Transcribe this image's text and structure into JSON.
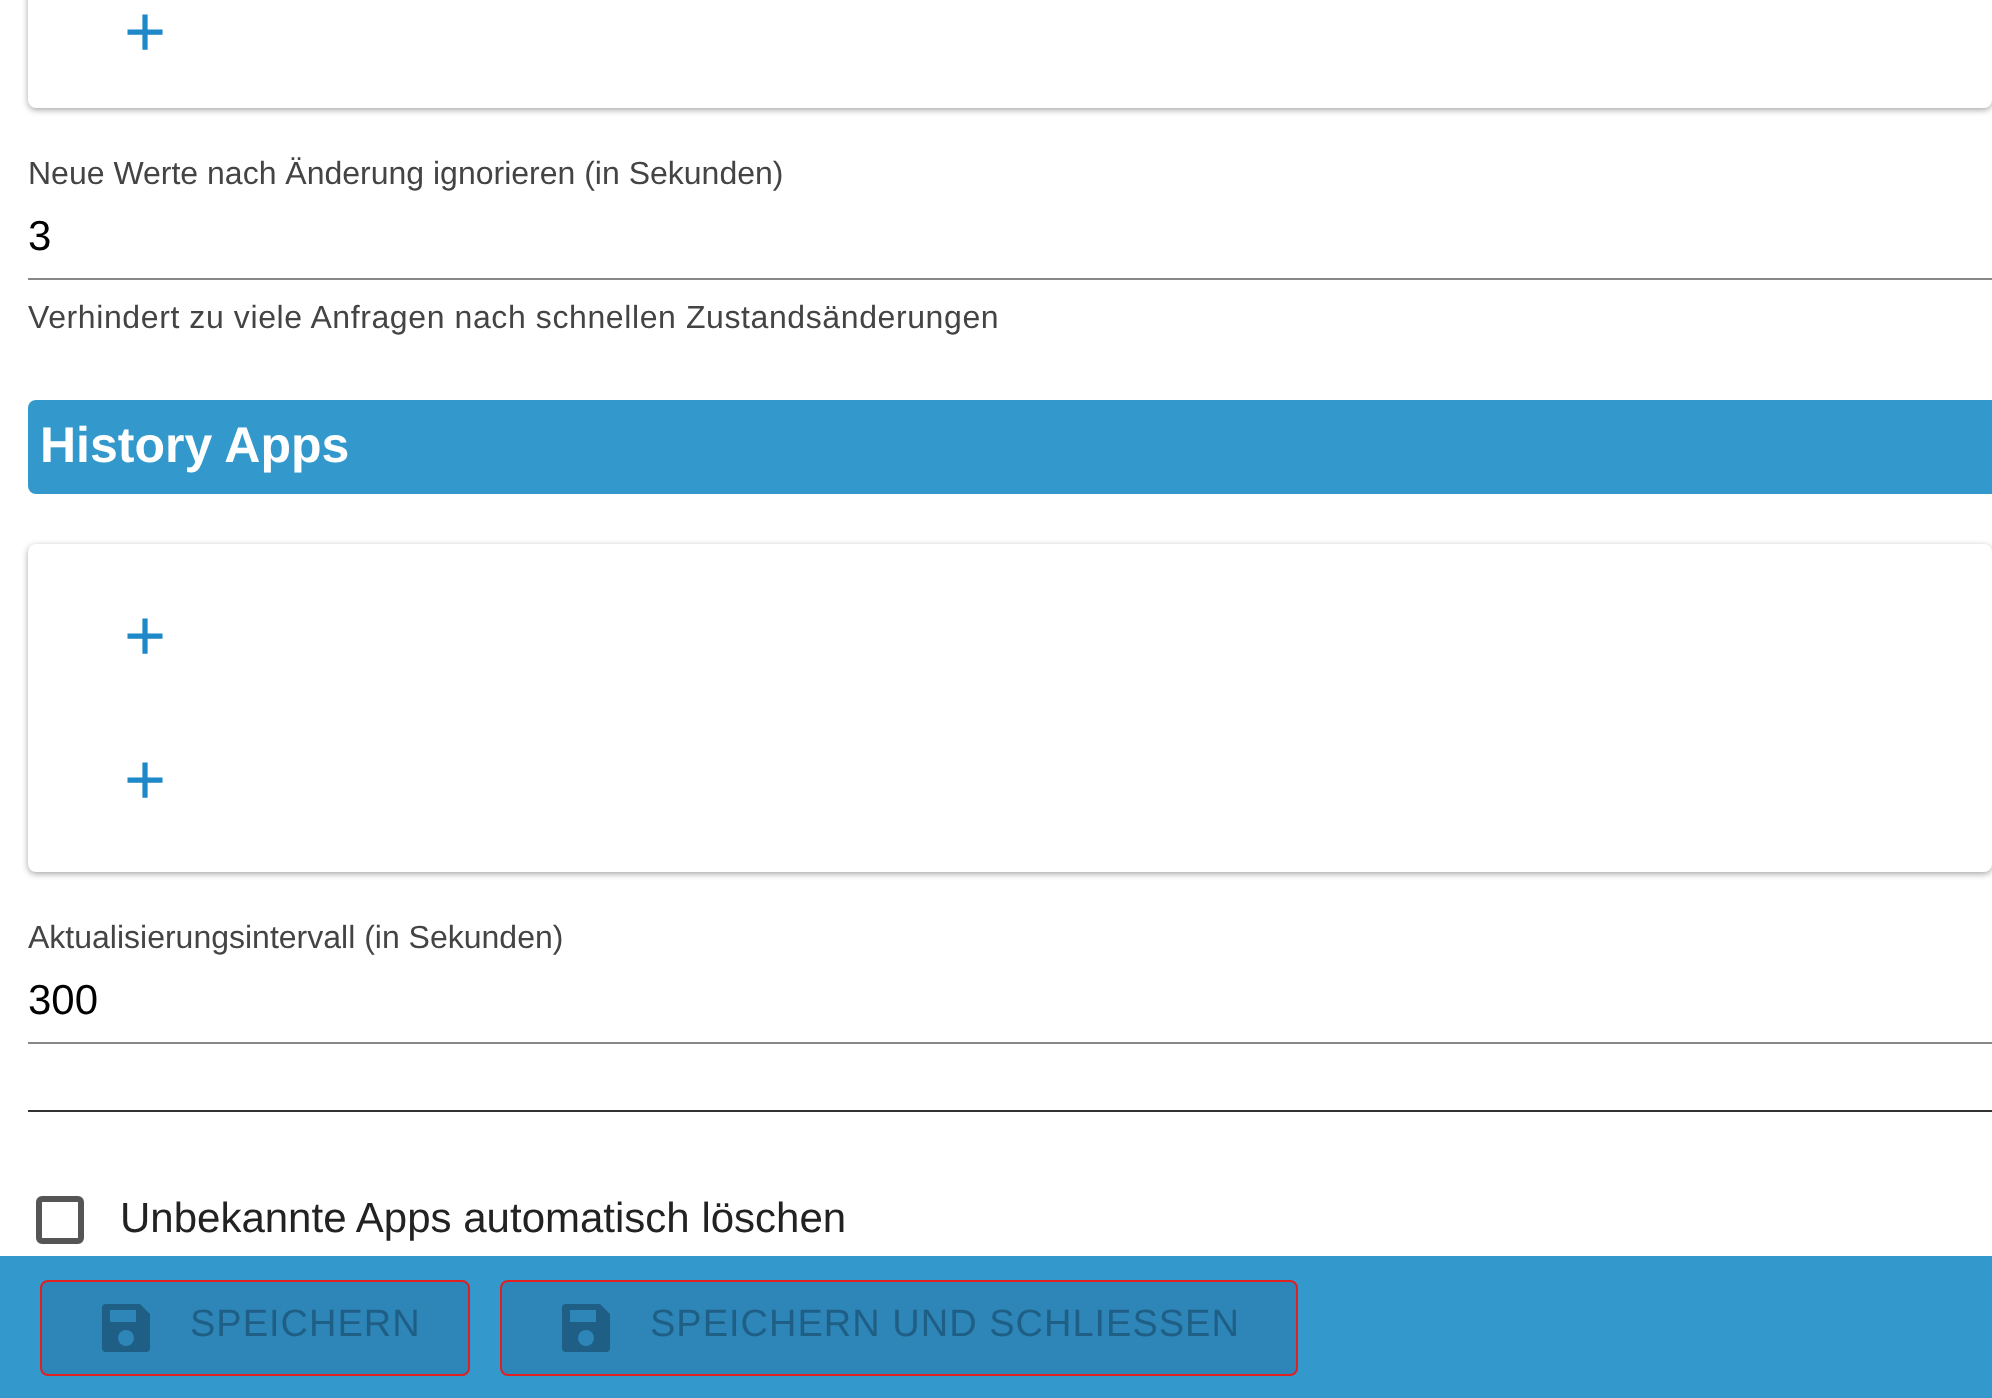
{
  "top_card": {
    "add_buttons": [
      "+"
    ]
  },
  "ignore_field": {
    "label": "Neue Werte nach Änderung ignorieren (in Sekunden)",
    "value": "3",
    "helper": "Verhindert zu viele Anfragen nach schnellen Zustandsänderungen"
  },
  "section_header": "History Apps",
  "apps_card": {
    "add_buttons": [
      "+",
      "+"
    ]
  },
  "interval_field": {
    "label": "Aktualisierungsintervall (in Sekunden)",
    "value": "300"
  },
  "delete_unknown": {
    "label": "Unbekannte Apps automatisch löschen",
    "checked": false
  },
  "footer_buttons": [
    {
      "label": "SPEICHERN",
      "disabled": true
    },
    {
      "label": "SPEICHERN UND SCHLIESSEN",
      "disabled": true
    }
  ]
}
